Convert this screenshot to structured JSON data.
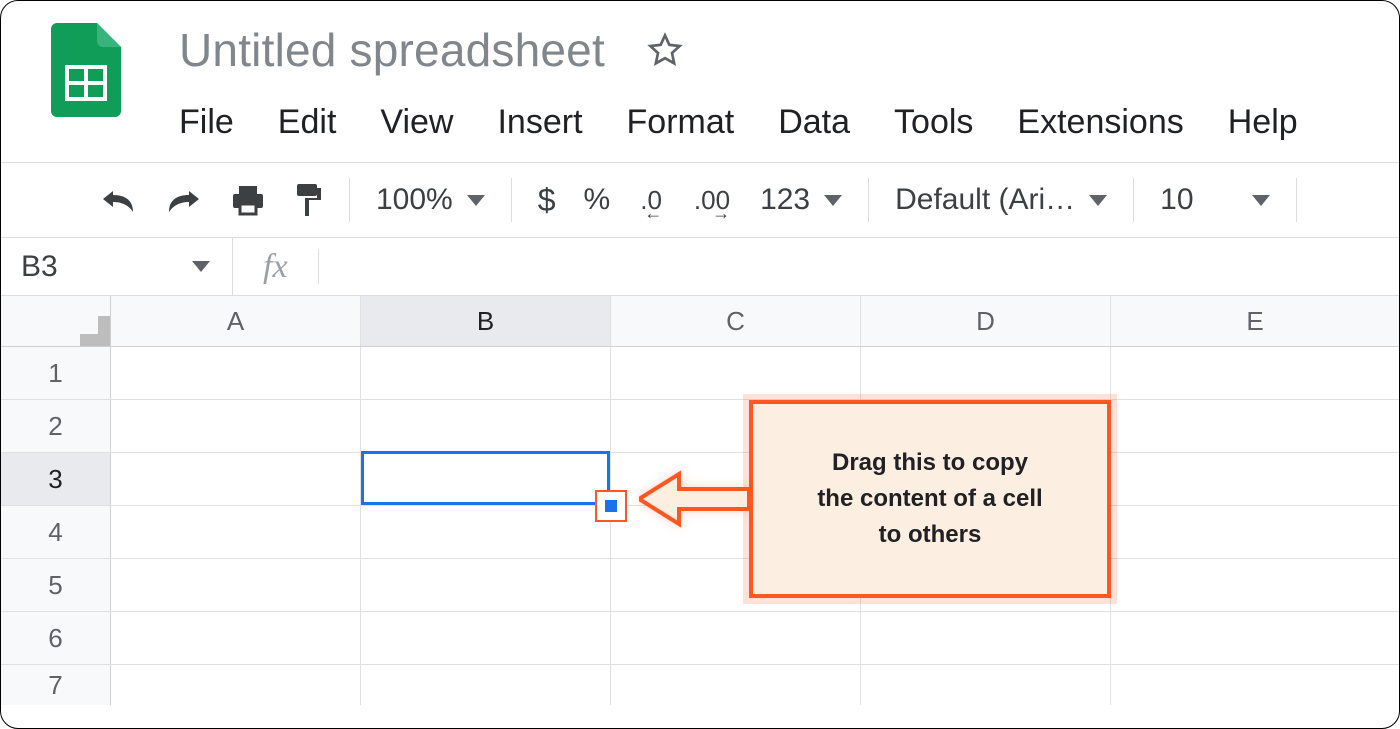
{
  "doc": {
    "title": "Untitled spreadsheet"
  },
  "menus": [
    "File",
    "Edit",
    "View",
    "Insert",
    "Format",
    "Data",
    "Tools",
    "Extensions",
    "Help"
  ],
  "toolbar": {
    "zoom": "100%",
    "currency": "$",
    "percent": "%",
    "dec_dec": ".0",
    "inc_dec": ".00",
    "more_formats": "123",
    "font": "Default (Ari…",
    "font_size": "10"
  },
  "namebox": "B3",
  "fx_label": "fx",
  "columns": [
    "A",
    "B",
    "C",
    "D",
    "E"
  ],
  "rows": [
    "1",
    "2",
    "3",
    "4",
    "5",
    "6",
    "7"
  ],
  "selection": {
    "col": "B",
    "row": "3"
  },
  "annotation": {
    "line1": "Drag this to copy",
    "line2": "the content of a cell",
    "line3": "to others"
  },
  "colors": {
    "accent": "#1a73e8",
    "anno": "#ff5722",
    "logo": "#0f9d58"
  }
}
